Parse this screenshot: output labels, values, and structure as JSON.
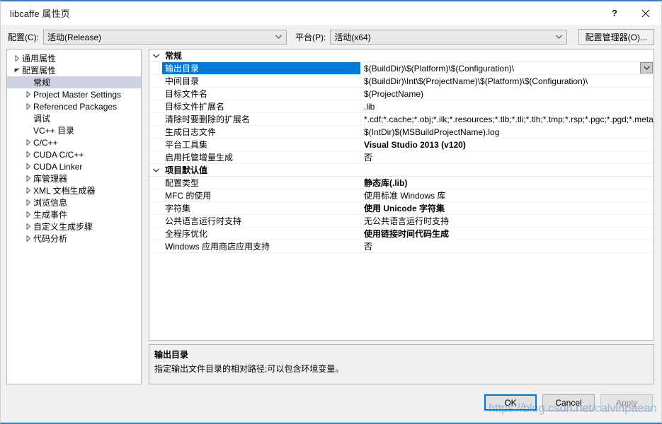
{
  "window": {
    "title": "libcaffe 属性页",
    "help_icon": "question-mark-icon",
    "close_icon": "close-icon"
  },
  "config_bar": {
    "config_label": "配置(C):",
    "config_value": "活动(Release)",
    "platform_label": "平台(P):",
    "platform_value": "活动(x64)",
    "config_manager_button": "配置管理器(O)..."
  },
  "tree": {
    "items": [
      {
        "label": "通用属性",
        "indent": 0,
        "twisty": "collapsed",
        "selected": false
      },
      {
        "label": "配置属性",
        "indent": 0,
        "twisty": "expanded",
        "selected": false
      },
      {
        "label": "常规",
        "indent": 1,
        "twisty": "none",
        "selected": true
      },
      {
        "label": "Project Master Settings",
        "indent": 1,
        "twisty": "collapsed",
        "selected": false
      },
      {
        "label": "Referenced Packages",
        "indent": 1,
        "twisty": "collapsed",
        "selected": false
      },
      {
        "label": "调试",
        "indent": 1,
        "twisty": "none",
        "selected": false
      },
      {
        "label": "VC++ 目录",
        "indent": 1,
        "twisty": "none",
        "selected": false
      },
      {
        "label": "C/C++",
        "indent": 1,
        "twisty": "collapsed",
        "selected": false
      },
      {
        "label": "CUDA C/C++",
        "indent": 1,
        "twisty": "collapsed",
        "selected": false
      },
      {
        "label": "CUDA Linker",
        "indent": 1,
        "twisty": "collapsed",
        "selected": false
      },
      {
        "label": "库管理器",
        "indent": 1,
        "twisty": "collapsed",
        "selected": false
      },
      {
        "label": "XML 文档生成器",
        "indent": 1,
        "twisty": "collapsed",
        "selected": false
      },
      {
        "label": "浏览信息",
        "indent": 1,
        "twisty": "collapsed",
        "selected": false
      },
      {
        "label": "生成事件",
        "indent": 1,
        "twisty": "collapsed",
        "selected": false
      },
      {
        "label": "自定义生成步骤",
        "indent": 1,
        "twisty": "collapsed",
        "selected": false
      },
      {
        "label": "代码分析",
        "indent": 1,
        "twisty": "collapsed",
        "selected": false
      }
    ]
  },
  "grid": {
    "rows": [
      {
        "kind": "section",
        "name": "常规"
      },
      {
        "kind": "prop",
        "name": "输出目录",
        "value": "$(BuildDir)\\$(Platform)\\$(Configuration)\\",
        "selected": true,
        "bold": false,
        "dropdown": true
      },
      {
        "kind": "prop",
        "name": "中间目录",
        "value": "$(BuildDir)\\Int\\$(ProjectName)\\$(Platform)\\$(Configuration)\\",
        "selected": false,
        "bold": false,
        "dropdown": false
      },
      {
        "kind": "prop",
        "name": "目标文件名",
        "value": "$(ProjectName)",
        "selected": false,
        "bold": false,
        "dropdown": false
      },
      {
        "kind": "prop",
        "name": "目标文件扩展名",
        "value": ".lib",
        "selected": false,
        "bold": false,
        "dropdown": false
      },
      {
        "kind": "prop",
        "name": "清除时要删除的扩展名",
        "value": "*.cdf;*.cache;*.obj;*.ilk;*.resources;*.tlb;*.tli;*.tlh;*.tmp;*.rsp;*.pgc;*.pgd;*.meta;",
        "selected": false,
        "bold": false,
        "dropdown": false
      },
      {
        "kind": "prop",
        "name": "生成日志文件",
        "value": "$(IntDir)$(MSBuildProjectName).log",
        "selected": false,
        "bold": false,
        "dropdown": false
      },
      {
        "kind": "prop",
        "name": "平台工具集",
        "value": "Visual Studio 2013 (v120)",
        "selected": false,
        "bold": true,
        "dropdown": false
      },
      {
        "kind": "prop",
        "name": "启用托管增量生成",
        "value": "否",
        "selected": false,
        "bold": false,
        "dropdown": false
      },
      {
        "kind": "section",
        "name": "项目默认值"
      },
      {
        "kind": "prop",
        "name": "配置类型",
        "value": "静态库(.lib)",
        "selected": false,
        "bold": true,
        "dropdown": false
      },
      {
        "kind": "prop",
        "name": "MFC 的使用",
        "value": "使用标准 Windows 库",
        "selected": false,
        "bold": false,
        "dropdown": false
      },
      {
        "kind": "prop",
        "name": "字符集",
        "value": "使用 Unicode 字符集",
        "selected": false,
        "bold": true,
        "dropdown": false
      },
      {
        "kind": "prop",
        "name": "公共语言运行时支持",
        "value": "无公共语言运行时支持",
        "selected": false,
        "bold": false,
        "dropdown": false
      },
      {
        "kind": "prop",
        "name": "全程序优化",
        "value": "使用链接时间代码生成",
        "selected": false,
        "bold": true,
        "dropdown": false
      },
      {
        "kind": "prop",
        "name": "Windows 应用商店应用支持",
        "value": "否",
        "selected": false,
        "bold": false,
        "dropdown": false
      }
    ]
  },
  "description": {
    "title": "输出目录",
    "text": "指定输出文件目录的相对路径;可以包含环境变量。"
  },
  "footer": {
    "ok_label": "OK",
    "cancel_label": "Cancel",
    "apply_label": "Apply"
  },
  "watermark": {
    "text": "https://blog.csdn.net/calvinpaean"
  },
  "colors": {
    "accent": "#2f7fd0",
    "selection": "#0078d7",
    "tree_selection": "#cdd3e3",
    "dialog_bg": "#f0f0f0"
  }
}
